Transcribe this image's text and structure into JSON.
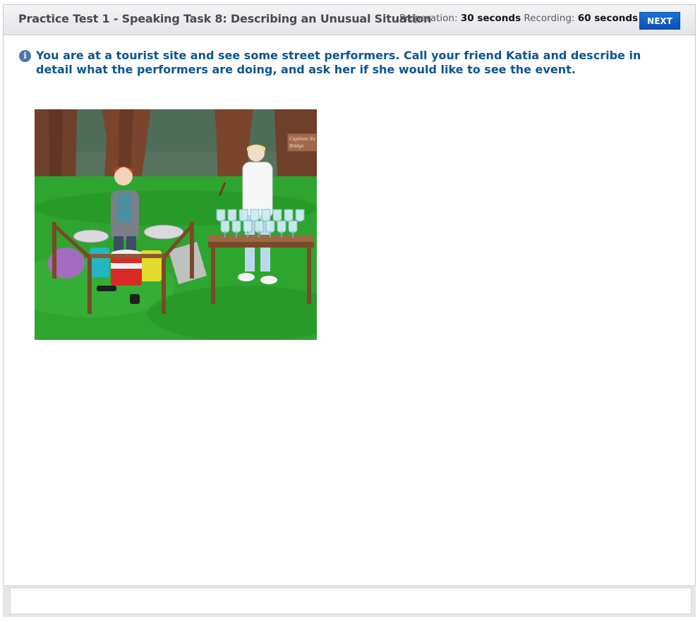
{
  "header": {
    "title": "Practice Test 1 - Speaking Task 8: Describing an Unusual Situation",
    "preparation_label": "Preparation:",
    "preparation_value": "30 seconds",
    "recording_label": "Recording:",
    "recording_value": "60 seconds",
    "next_label": "NEXT"
  },
  "instruction": {
    "icon": "info-icon",
    "text": "You are at a tourist site and see some street performers. Call your friend Katia and describe in detail what the performers are doing, and ask her if she would like to see the event."
  },
  "illustration": {
    "sign_text_line1": "Capilano Su",
    "sign_text_line2": "Bridge"
  },
  "colors": {
    "accent": "#0c5590",
    "button": "#1560c4",
    "grass": "#2ea52f"
  }
}
